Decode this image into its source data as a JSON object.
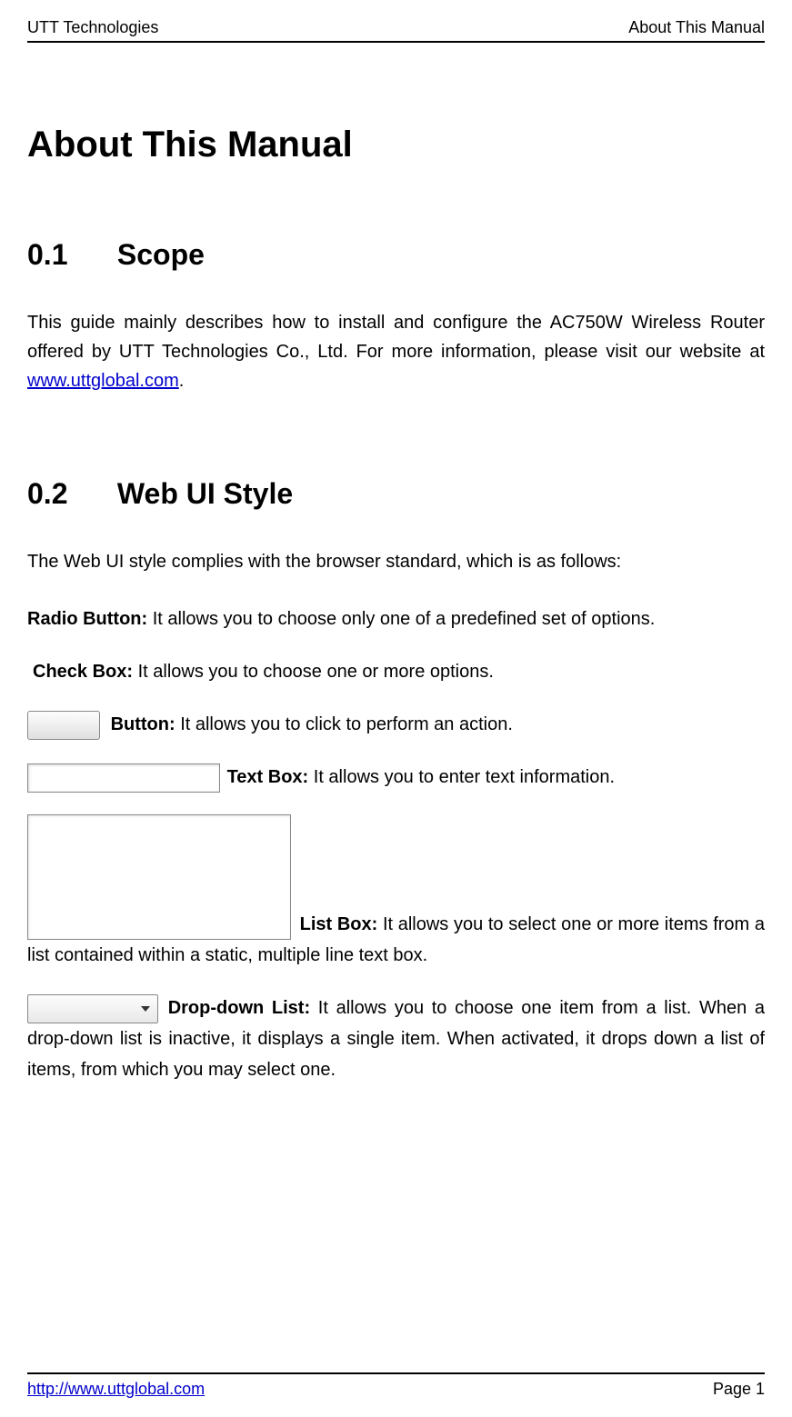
{
  "header": {
    "left": "UTT Technologies",
    "right": "About This Manual"
  },
  "title": "About This Manual",
  "sections": {
    "scope": {
      "number": "0.1",
      "heading": "Scope",
      "para_before_link": "This guide mainly describes how to install and configure the AC750W Wireless Router offered by UTT Technologies Co., Ltd. For more information, please visit our website at ",
      "link_text": "www.uttglobal.com",
      "para_after_link": "."
    },
    "webui": {
      "number": "0.2",
      "heading": "Web UI Style",
      "intro": "The Web UI style complies with the browser standard, which is as follows:",
      "radio": {
        "label": "Radio Button:",
        "text": " It allows you to choose only one of a predefined set of options."
      },
      "checkbox": {
        "label": "Check Box:",
        "text": " It allows you to choose one or more options."
      },
      "button": {
        "label": "Button:",
        "text": " It allows you to click to perform an action."
      },
      "textbox": {
        "label": "Text Box:",
        "text": " It allows you to enter text information."
      },
      "listbox": {
        "label": "List Box:",
        "text_after": " It allows you to select one or more items from a list contained within a static, multiple line text box."
      },
      "dropdown": {
        "label": "Drop-down List:",
        "text_after": " It allows you to choose one item from a list. When a drop-down list is inactive, it displays a single item. When activated, it drops down a list of items, from which you may select one."
      }
    }
  },
  "footer": {
    "url": "http://www.uttglobal.com",
    "page": "Page 1"
  }
}
